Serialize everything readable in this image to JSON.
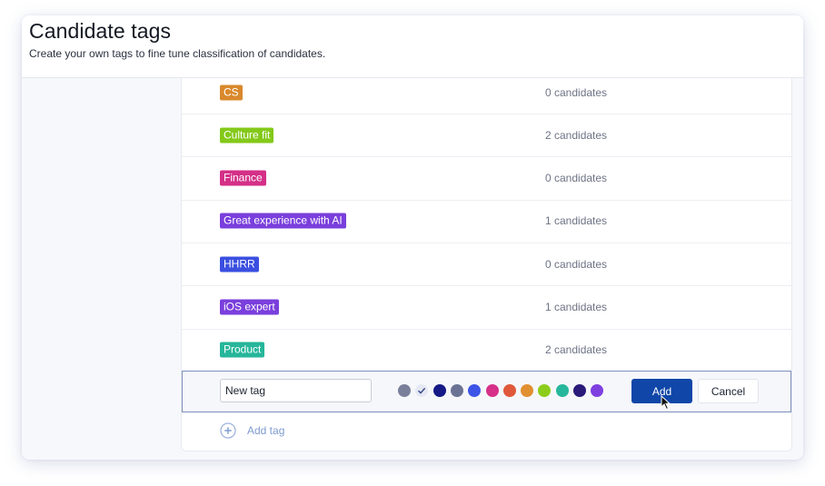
{
  "header": {
    "title": "Candidate tags",
    "subtitle": "Create your own tags to fine tune classification of candidates."
  },
  "tags": [
    {
      "label": "CS",
      "color": "#d9892c",
      "count_text": "0 candidates"
    },
    {
      "label": "Culture fit",
      "color": "#84c91a",
      "count_text": "2 candidates"
    },
    {
      "label": "Finance",
      "color": "#d42f87",
      "count_text": "0 candidates"
    },
    {
      "label": "Great experience with AI",
      "color": "#7a3fdc",
      "count_text": "1 candidates"
    },
    {
      "label": "HHRR",
      "color": "#3a4fe0",
      "count_text": "0 candidates"
    },
    {
      "label": "iOS expert",
      "color": "#7a3fdc",
      "count_text": "1 candidates"
    },
    {
      "label": "Product",
      "color": "#26b69a",
      "count_text": "2 candidates"
    }
  ],
  "new_tag": {
    "value": "New tag",
    "colors": [
      {
        "name": "gray",
        "hex": "#7a809a"
      },
      {
        "name": "light-gray",
        "hex": "#e6e9f3",
        "selected": true
      },
      {
        "name": "navy",
        "hex": "#151a86"
      },
      {
        "name": "slate",
        "hex": "#6b7394"
      },
      {
        "name": "blue",
        "hex": "#3d55e6"
      },
      {
        "name": "pink",
        "hex": "#d63088"
      },
      {
        "name": "red-orange",
        "hex": "#e0583a"
      },
      {
        "name": "orange",
        "hex": "#e08f31"
      },
      {
        "name": "lime",
        "hex": "#8ccd1c"
      },
      {
        "name": "teal",
        "hex": "#27b79c"
      },
      {
        "name": "indigo",
        "hex": "#2a1a7a"
      },
      {
        "name": "purple",
        "hex": "#7f40e0"
      }
    ],
    "add_label": "Add",
    "cancel_label": "Cancel"
  },
  "add_tag_label": "Add tag",
  "icons": {
    "check": "check-icon",
    "plus": "plus-circle-icon",
    "cursor": "mouse-pointer-icon"
  }
}
